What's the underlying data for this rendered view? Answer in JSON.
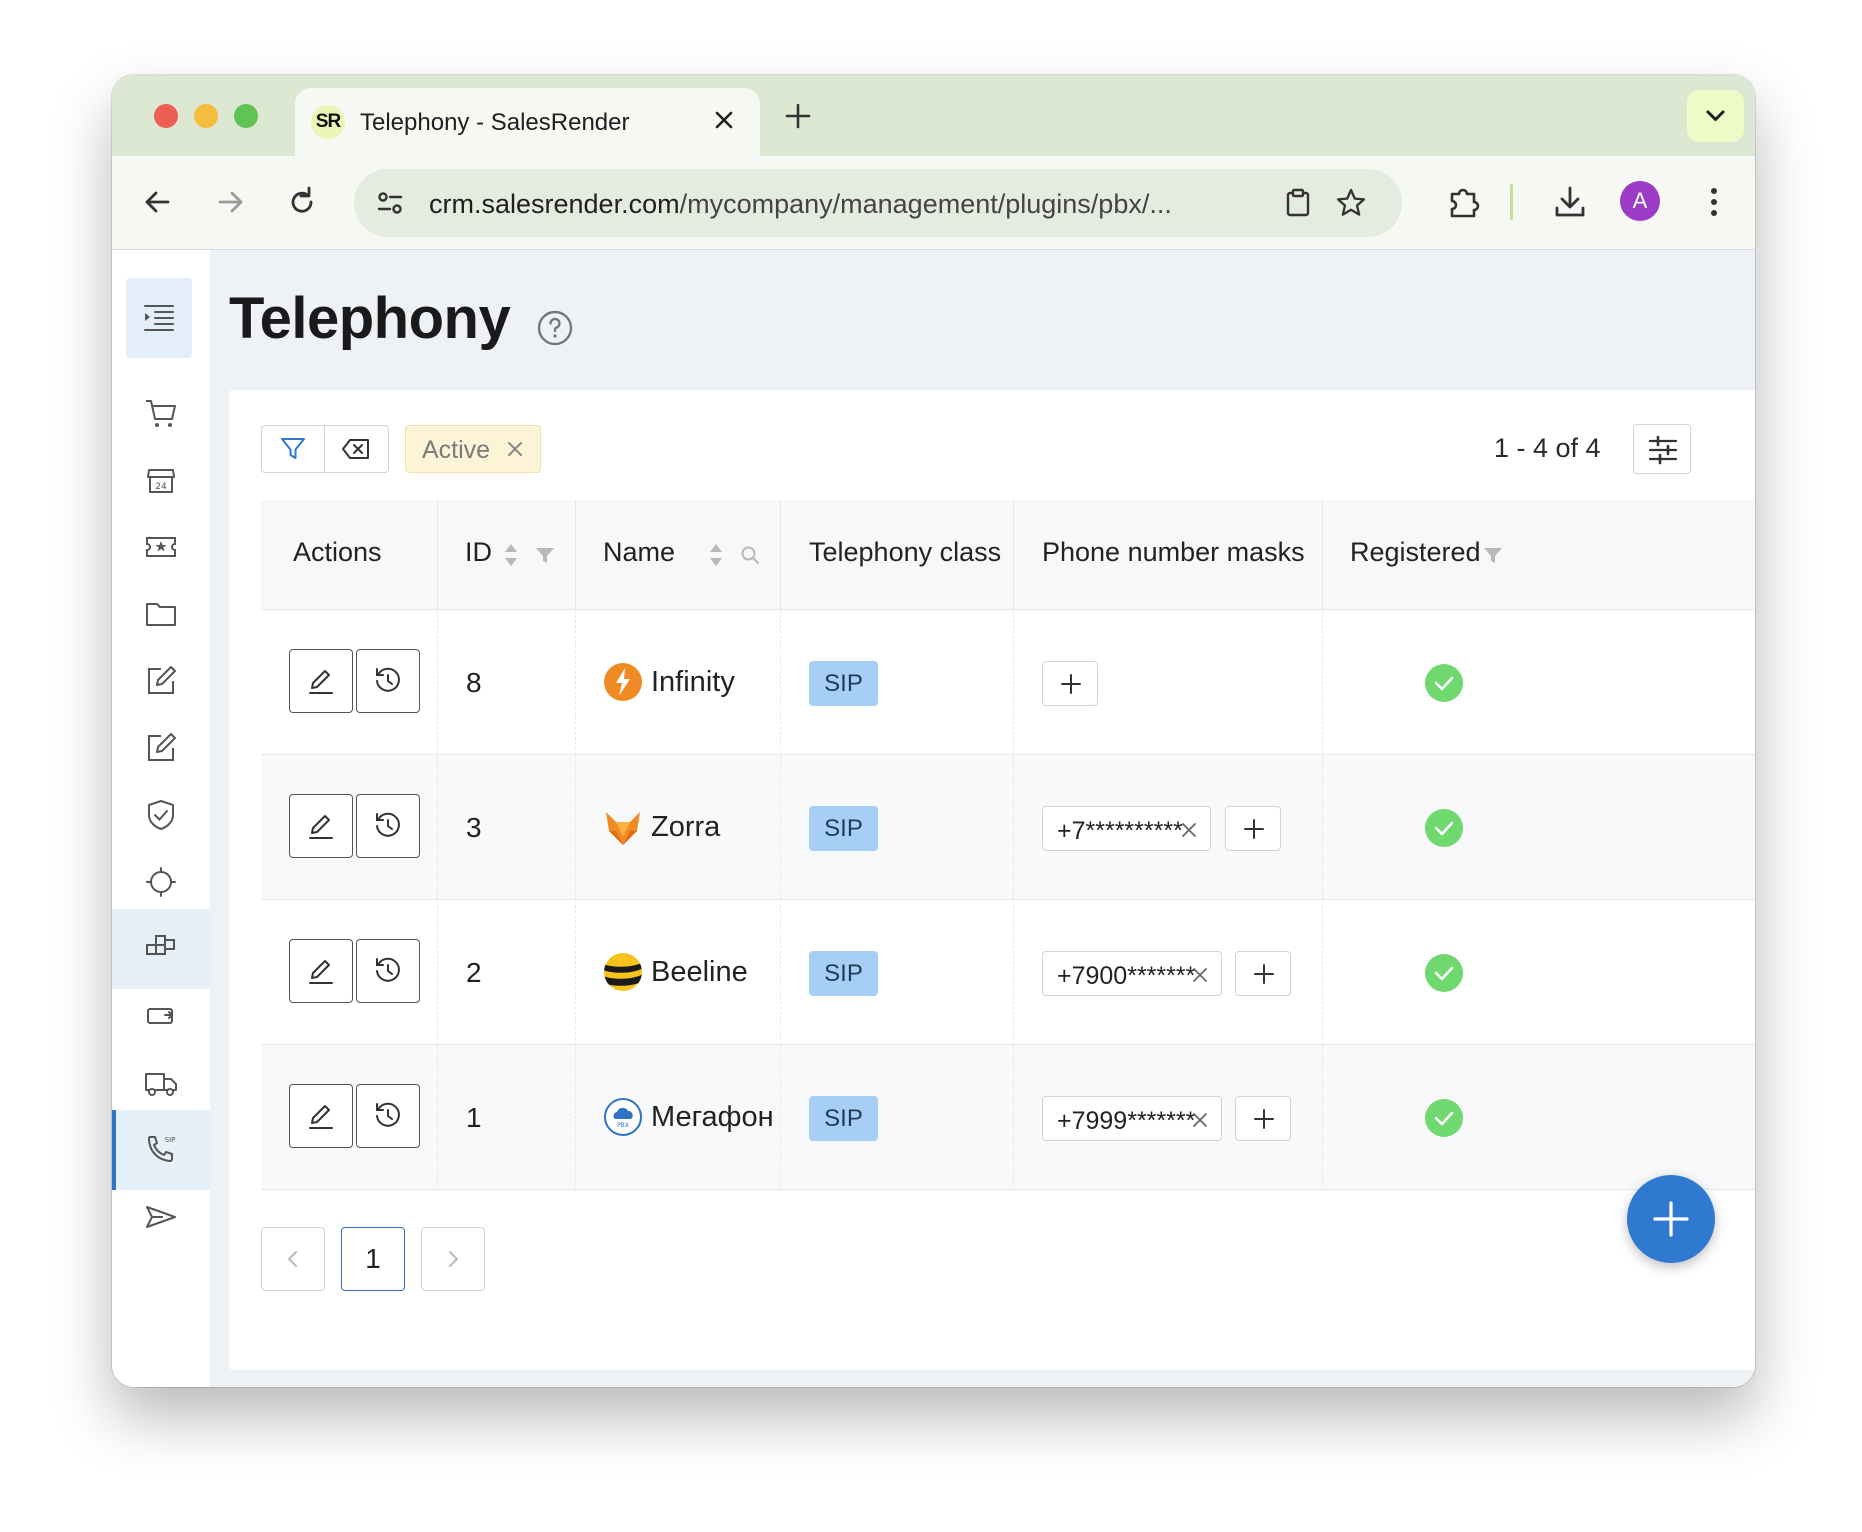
{
  "browser": {
    "tab_title": "Telephony - SalesRender",
    "favicon_text": "SR",
    "url_host": "crm.salesrender.com",
    "url_path": "/mycompany/management/plugins/pbx/...",
    "avatar_letter": "A"
  },
  "page": {
    "title": "Telephony"
  },
  "filters": {
    "chip_label": "Active",
    "range_text": "1 - 4 of 4"
  },
  "table": {
    "columns": [
      "Actions",
      "ID",
      "Name",
      "Telephony class",
      "Phone number masks",
      "Registered"
    ],
    "rows": [
      {
        "id": "8",
        "name": "Infinity",
        "class": "SIP",
        "masks": [],
        "registered": true
      },
      {
        "id": "3",
        "name": "Zorra",
        "class": "SIP",
        "masks": [
          "+7**********"
        ],
        "registered": true
      },
      {
        "id": "2",
        "name": "Beeline",
        "class": "SIP",
        "masks": [
          "+7900*******"
        ],
        "registered": true
      },
      {
        "id": "1",
        "name": "Мегафон",
        "class": "SIP",
        "masks": [
          "+7999*******"
        ],
        "registered": true
      }
    ]
  },
  "pagination": {
    "current_page": "1"
  },
  "colors": {
    "accent": "#2f7ad0",
    "sip_badge": "#a7cff5",
    "registered_ok": "#6fd86f",
    "filter_chip": "#fdf3d6"
  }
}
